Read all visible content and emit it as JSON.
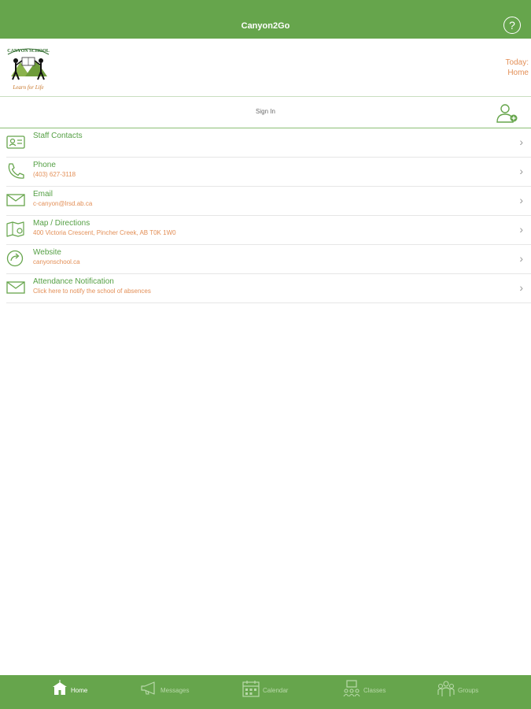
{
  "header": {
    "title": "Canyon2Go",
    "help_icon_glyph": "?"
  },
  "school": {
    "logo_text_top": "CANYON SCHOOL",
    "logo_text_bottom": "Learn for Life",
    "today_label": "Today:",
    "today_value": "Home"
  },
  "signin": {
    "label": "Sign In"
  },
  "list": [
    {
      "label": "Staff Contacts",
      "sub": "",
      "icon": "contact-card-icon"
    },
    {
      "label": "Phone",
      "sub": "(403) 627-3118",
      "icon": "phone-icon"
    },
    {
      "label": "Email",
      "sub": "c-canyon@lrsd.ab.ca",
      "icon": "envelope-icon"
    },
    {
      "label": "Map / Directions",
      "sub": "400 Victoria Crescent, Pincher Creek, AB T0K 1W0",
      "icon": "map-icon"
    },
    {
      "label": "Website",
      "sub": "canyonschool.ca",
      "icon": "globe-arrow-icon"
    },
    {
      "label": "Attendance Notification",
      "sub": "Click here to notify the school of absences",
      "icon": "envelope-icon"
    }
  ],
  "tabs": [
    {
      "label": "Home",
      "icon": "school-icon",
      "active": true
    },
    {
      "label": "Messages",
      "icon": "megaphone-icon",
      "active": false
    },
    {
      "label": "Calendar",
      "icon": "calendar-icon",
      "active": false
    },
    {
      "label": "Classes",
      "icon": "classroom-icon",
      "active": false
    },
    {
      "label": "Groups",
      "icon": "group-icon",
      "active": false
    }
  ],
  "colors": {
    "brand_green": "#66a54c",
    "accent_orange": "#e38f57"
  }
}
